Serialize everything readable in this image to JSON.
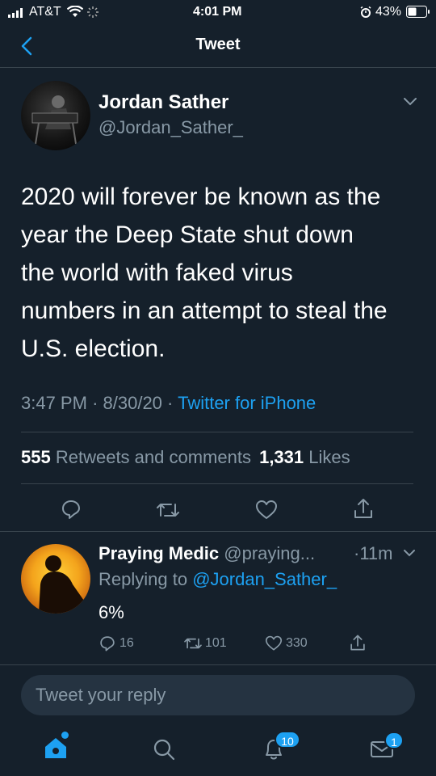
{
  "status_bar": {
    "carrier": "AT&T",
    "time": "4:01 PM",
    "battery": "43%"
  },
  "nav": {
    "title": "Tweet"
  },
  "tweet": {
    "author_name": "Jordan Sather",
    "author_handle": "@Jordan_Sather_",
    "text_lines": [
      "2020 will forever be known as the",
      "year the Deep State shut down",
      "the world with faked virus",
      "numbers in an attempt to steal the",
      "U.S. election."
    ],
    "time": "3:47 PM",
    "date": "8/30/20",
    "sep": "·",
    "client": "Twitter for iPhone",
    "retweets_count": "555",
    "retweets_label": "Retweets and comments",
    "likes_count": "1,331",
    "likes_label": "Likes"
  },
  "reply": {
    "author_name": "Praying Medic",
    "author_handle": "@praying...",
    "age": "·11m",
    "replying_prefix": "Replying to",
    "replying_to": "@Jordan_Sather_",
    "text": "6%",
    "comments": "16",
    "retweets": "101",
    "likes": "330"
  },
  "composer": {
    "placeholder": "Tweet your reply"
  },
  "tabbar": {
    "notifications_badge": "10",
    "messages_badge": "1"
  },
  "colors": {
    "background": "#15202b",
    "accent": "#1da1f2",
    "muted": "#8899a6"
  }
}
